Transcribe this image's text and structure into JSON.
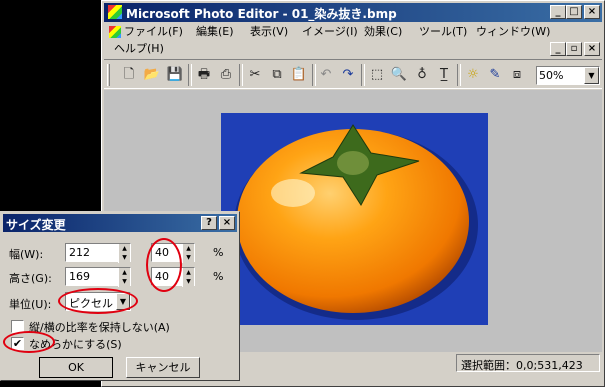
{
  "app": {
    "title": "Microsoft Photo Editor - 01_染み抜き.bmp",
    "title_buttons": [
      "_",
      "□",
      "×"
    ],
    "doc_buttons": [
      "_",
      "▫",
      "×"
    ]
  },
  "menu": [
    "ファイル(F)",
    "編集(E)",
    "表示(V)",
    "イメージ(I)",
    "効果(C)",
    "ツール(T)",
    "ウィンドウ(W)",
    "ヘルプ(H)"
  ],
  "toolbar": {
    "zoom_value": "50%",
    "icons": [
      "new-icon",
      "open-icon",
      "save-icon",
      "print-icon",
      "scan-icon",
      "cut-icon",
      "copy-icon",
      "paste-icon",
      "undo-icon",
      "redo-icon",
      "select-icon",
      "zoom-icon",
      "eyedropper-icon",
      "text-icon",
      "sharpen-icon",
      "smudge-icon",
      "crop-icon"
    ]
  },
  "statusbar": {
    "selection": "選択範囲：0,0;531,423"
  },
  "dialog": {
    "title": "サイズ変更",
    "help_button": "?",
    "close_button": "×",
    "width_label": "幅(W):",
    "width_px": "212",
    "width_pct": "40",
    "height_label": "高さ(G):",
    "height_px": "169",
    "height_pct": "40",
    "percent_sign": "%",
    "unit_label": "単位(U):",
    "unit_value": "ピクセル",
    "keep_ratio_label": "縦/横の比率を保持しない(A)",
    "keep_ratio_checked": false,
    "smooth_label": "なめらかにする(S)",
    "smooth_checked": true,
    "ok": "OK",
    "cancel": "キャンセル"
  },
  "colors": {
    "title_gradient_start": "#0a246a",
    "title_gradient_end": "#3a6ea5",
    "face": "#d4d0c8",
    "image_bg": "#1f3fb6",
    "annotation": "#e00010"
  }
}
